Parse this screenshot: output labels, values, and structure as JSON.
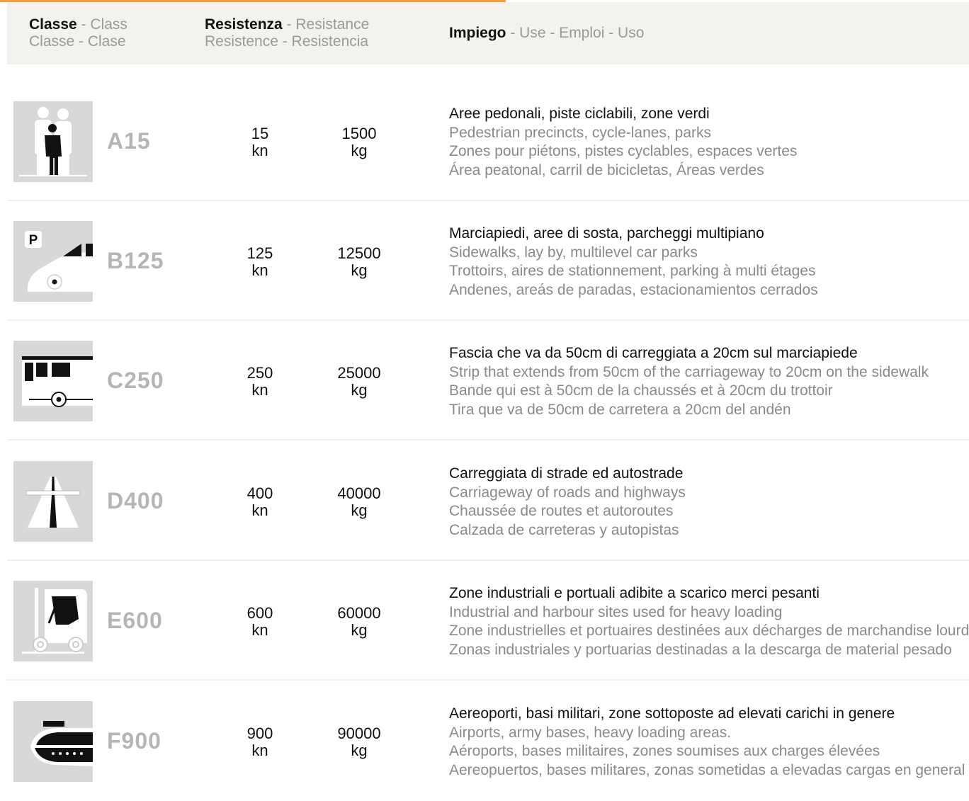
{
  "header": {
    "class_label": "Classe",
    "class_sub1": " - Class",
    "class_sub2": "Classe - Clase",
    "res_label": "Resistenza",
    "res_sub1": " - Resistance",
    "res_sub2": "Resistence - Resistencia",
    "use_label": "Impiego",
    "use_sub": " - Use - Emploi - Uso"
  },
  "rows": [
    {
      "icon": "pedestrian-icon",
      "code": "A15",
      "kn": "15",
      "kn_unit": "kn",
      "kg": "1500",
      "kg_unit": "kg",
      "it": "Aree pedonali, piste ciclabili, zone verdi",
      "en": "Pedestrian precincts, cycle-lanes, parks",
      "fr": "Zones  pour piétons, pistes cyclables, espaces  vertes",
      "es": "Área peatonal, carril de bicicletas, Áreas verdes"
    },
    {
      "icon": "parking-car-icon",
      "code": "B125",
      "kn": "125",
      "kn_unit": "kn",
      "kg": "12500",
      "kg_unit": "kg",
      "it": "Marciapiedi, aree di sosta, parcheggi multipiano",
      "en": "Sidewalks, lay by, multilevel car parks",
      "fr": "Trottoirs, aires de stationnement, parking à multi étages",
      "es": "Andenes, areás de paradas, estacionamientos cerrados"
    },
    {
      "icon": "bus-icon",
      "code": "C250",
      "kn": "250",
      "kn_unit": "kn",
      "kg": "25000",
      "kg_unit": "kg",
      "it": "Fascia che va da 50cm di carreggiata a 20cm sul marciapiede",
      "en": "Strip that extends from 50cm of the carriageway to 20cm on the sidewalk",
      "fr": "Bande qui est à 50cm de la chaussés et à 20cm du trottoir",
      "es": "Tira que va de 50cm de carretera a 20cm del andén"
    },
    {
      "icon": "highway-icon",
      "code": "D400",
      "kn": "400",
      "kn_unit": "kn",
      "kg": "40000",
      "kg_unit": "kg",
      "it": "Carreggiata di strade ed autostrade",
      "en": "Carriageway of roads and highways",
      "fr": "Chaussée de routes et autoroutes",
      "es": "Calzada de carreteras y autopistas"
    },
    {
      "icon": "forklift-icon",
      "code": "E600",
      "kn": "600",
      "kn_unit": "kn",
      "kg": "60000",
      "kg_unit": "kg",
      "it": "Zone industriali e portuali adibite a scarico merci pesanti",
      "en": "Industrial and harbour sites used for heavy loading",
      "fr": "Zone industrielles et portuaires destinées aux décharges de marchandise lourdes",
      "es": "Zonas industriales y portuarias destinadas a la descarga de material pesado"
    },
    {
      "icon": "airplane-icon",
      "code": "F900",
      "kn": "900",
      "kn_unit": "kn",
      "kg": "90000",
      "kg_unit": "kg",
      "it": "Aereoporti, basi militari, zone sottoposte ad elevati carichi in genere",
      "en": "Airports, army bases, heavy loading areas.",
      "fr": "Aéroports, bases militaires, zones soumises aux charges élevées",
      "es": "Aereopuertos, bases militares, zonas sometidas a elevadas cargas en general"
    }
  ],
  "colors": {
    "accent": "#f0a04a",
    "header_bg": "#f4f2ef",
    "icon_bg": "#d8d8d8",
    "code": "#b5b5b5"
  }
}
